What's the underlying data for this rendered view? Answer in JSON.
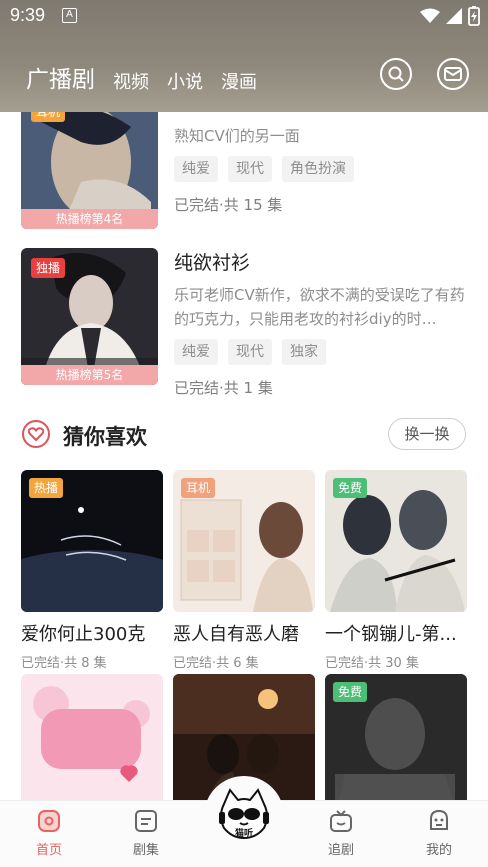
{
  "status_bar": {
    "time": "9:39",
    "notif": "A"
  },
  "header": {
    "tabs": [
      {
        "label": "广播剧",
        "active": true
      },
      {
        "label": "视频"
      },
      {
        "label": "小说"
      },
      {
        "label": "漫画"
      }
    ]
  },
  "ranking": [
    {
      "title": "",
      "desc": "熟知CV们的另一面",
      "tags": [
        "纯爱",
        "现代",
        "角色扮演"
      ],
      "status": "已完结·共 15 集",
      "rank_label": "热播榜第4名",
      "badge": "耳机"
    },
    {
      "title": "纯欲衬衫",
      "desc": "乐可老师CV新作，欲求不满的受误吃了有药的巧克力，只能用老攻的衬衫diy的时…",
      "tags": [
        "纯爱",
        "现代",
        "独家"
      ],
      "status": "已完结·共 1 集",
      "rank_label": "热播榜第5名",
      "badge": "独播"
    }
  ],
  "guess": {
    "title": "猜你喜欢",
    "refresh": "换一换",
    "items": [
      {
        "title": "爱你何止300克",
        "status": "已完结·共 8 集",
        "badge": "热播"
      },
      {
        "title": "恶人自有恶人磨",
        "status": "已完结·共 6 集",
        "badge": "耳机"
      },
      {
        "title": "一个钢镚儿-第...",
        "status": "已完结·共 30 集",
        "badge": "免费"
      },
      {
        "title": "",
        "status": "",
        "badge": ""
      },
      {
        "title": "",
        "status": "",
        "badge": ""
      },
      {
        "title": "",
        "status": "",
        "badge": "免费"
      }
    ]
  },
  "bottom_nav": [
    {
      "label": "首页",
      "icon": "home-icon",
      "active": true
    },
    {
      "label": "剧集",
      "icon": "series-icon"
    },
    {
      "label": "追剧",
      "icon": "tv-icon"
    },
    {
      "label": "我的",
      "icon": "profile-icon"
    }
  ],
  "center_logo_text": "猫听",
  "colors": {
    "accent": "#e8625f",
    "badge_red": "#e8403f",
    "badge_orange": "#f2a53c",
    "badge_green": "#4cbe76",
    "rank_pink": "#f2a7a9"
  }
}
